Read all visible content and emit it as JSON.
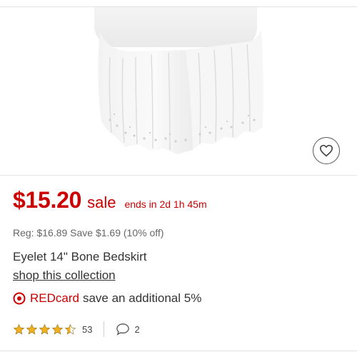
{
  "product": {
    "image_alt": "Eyelet bedskirt product image",
    "price": "$15.20",
    "sale_label": "sale",
    "sale_ends": "ends in 2d 1h 45m",
    "reg_info": "Reg: $16.89 Save $1.69 (10% off)",
    "title": "Eyelet 14\" Bone Bedskirt",
    "collection_link": "shop this collection",
    "redcard": {
      "name": "REDcard",
      "offer": "save an additional 5%"
    },
    "rating": {
      "stars": 4.5,
      "review_count": "53",
      "questions_count": "2"
    }
  },
  "icons": {
    "wishlist": "heart-icon",
    "redcard": "target-bullseye-icon",
    "questions": "speech-bubble-icon"
  },
  "colors": {
    "brand_red": "#cc0000",
    "star_gold": "#f2b01e",
    "text": "#333333"
  }
}
